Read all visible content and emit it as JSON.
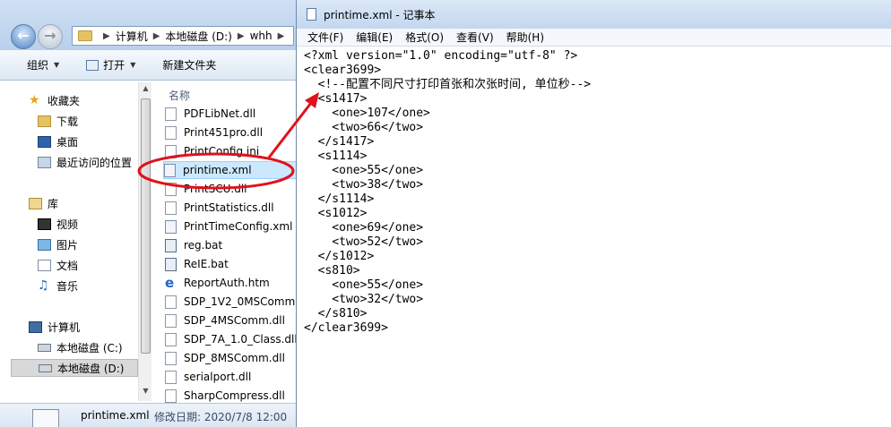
{
  "explorer": {
    "address": {
      "segments": [
        "计算机",
        "本地磁盘 (D:)",
        "whh"
      ]
    },
    "toolbar": {
      "organize": "组织",
      "open": "打开",
      "new_folder": "新建文件夹"
    },
    "nav": {
      "favorites": "收藏夹",
      "downloads": "下载",
      "desktop": "桌面",
      "recent": "最近访问的位置",
      "libraries": "库",
      "videos": "视频",
      "pictures": "图片",
      "documents": "文档",
      "music": "音乐",
      "computer": "计算机",
      "drive_c": "本地磁盘 (C:)",
      "drive_d": "本地磁盘 (D:)"
    },
    "file_list": {
      "column_name": "名称",
      "files": [
        "PDFLibNet.dll",
        "Print451pro.dll",
        "PrintConfig.ini",
        "printime.xml",
        "PrintSCU.dll",
        "PrintStatistics.dll",
        "PrintTimeConfig.xml",
        "reg.bat",
        "ReIE.bat",
        "ReportAuth.htm",
        "SDP_1V2_0MSComm",
        "SDP_4MSComm.dll",
        "SDP_7A_1.0_Class.dll",
        "SDP_8MSComm.dll",
        "serialport.dll",
        "SharpCompress.dll"
      ],
      "selected_index": 3
    },
    "details": {
      "name": "printime.xml",
      "modified": "修改日期: 2020/7/8 12:00"
    }
  },
  "notepad": {
    "title": "printime.xml - 记事本",
    "menu": [
      "文件(F)",
      "编辑(E)",
      "格式(O)",
      "查看(V)",
      "帮助(H)"
    ],
    "lines": [
      "<?xml version=\"1.0\" encoding=\"utf-8\" ?>",
      "<clear3699>",
      "  <!--配置不同尺寸打印首张和次张时间, 单位秒-->",
      "  <s1417>",
      "    <one>107</one>",
      "    <two>66</two>",
      "  </s1417>",
      "  <s1114>",
      "    <one>55</one>",
      "    <two>38</two>",
      "  </s1114>",
      "  <s1012>",
      "    <one>69</one>",
      "    <two>52</two>",
      "  </s1012>",
      "  <s810>",
      "    <one>55</one>",
      "    <two>32</two>",
      "  </s810>",
      "</clear3699>"
    ]
  },
  "colors": {
    "annotation": "#e0121b",
    "selection": "#cce8ff"
  }
}
